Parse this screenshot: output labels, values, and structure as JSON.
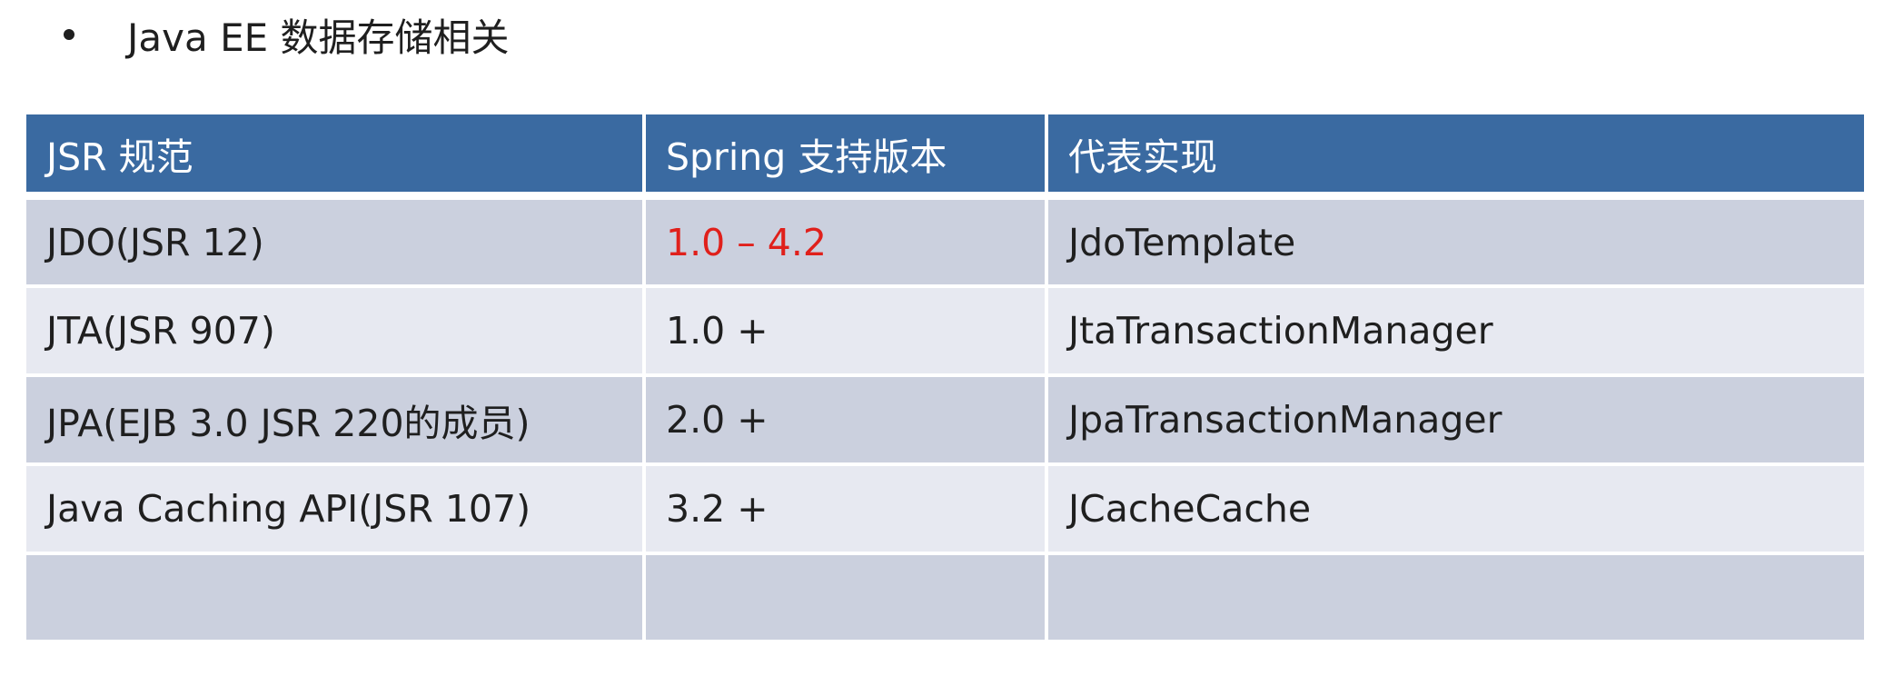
{
  "heading": {
    "text": "Java EE 数据存储相关"
  },
  "table": {
    "headers": [
      "JSR 规范",
      "Spring 支持版本",
      "代表实现"
    ],
    "rows": [
      [
        "JDO(JSR 12)",
        "1.0 – 4.2",
        "JdoTemplate"
      ],
      [
        "JTA(JSR 907)",
        "1.0 +",
        "JtaTransactionManager"
      ],
      [
        "JPA(EJB 3.0 JSR 220的成员)",
        "2.0 +",
        "JpaTransactionManager"
      ],
      [
        "Java Caching API(JSR 107)",
        "3.2 +",
        "JCacheCache"
      ],
      [
        "",
        "",
        ""
      ]
    ]
  },
  "colors": {
    "header_bg": "#3a6aa1",
    "row_dark": "#cbd0de",
    "row_light": "#e7e9f1",
    "highlight_text": "#e0201b"
  }
}
